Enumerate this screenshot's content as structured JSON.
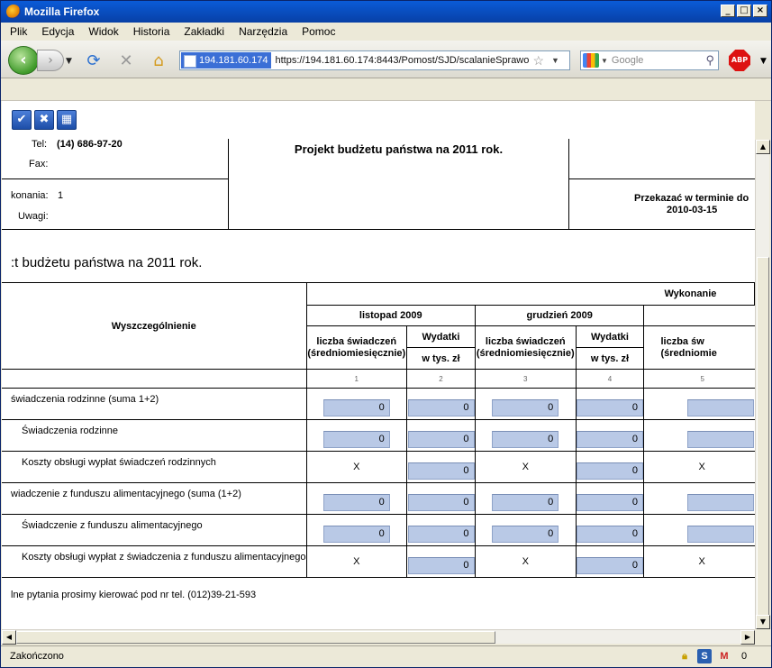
{
  "window": {
    "title": "Mozilla Firefox"
  },
  "menu": [
    "Plik",
    "Edycja",
    "Widok",
    "Historia",
    "Zakładki",
    "Narzędzia",
    "Pomoc"
  ],
  "nav": {
    "host": "194.181.60.174",
    "url": "https://194.181.60.174:8443/Pomost/SJD/scalanieSprawo",
    "search_placeholder": "Google",
    "abp_label": "ABP"
  },
  "header": {
    "tel_label": "Tel:",
    "tel_value": "(14) 686-97-20",
    "fax_label": "Fax:",
    "wykonania_label": "konania:",
    "wykonania_value": "1",
    "uwagi_label": "Uwagi:",
    "project_title": "Projekt budżetu państwa na 2011 rok.",
    "deadline_label": "Przekazać w terminie do",
    "deadline_date": "2010-03-15"
  },
  "section_title": ":t budżetu państwa na 2011 rok.",
  "table": {
    "col_main": "Wyszczególnienie",
    "group": "Wykonanie",
    "months": [
      "listopad 2009",
      "grudzień 2009"
    ],
    "sub_count": "liczba świadczeń (średniomiesięcznie)",
    "sub_count_partial": "liczba św (średniomie",
    "sub_exp": "Wydatki",
    "sub_unit": "w tys. zł",
    "col_numbers": [
      "1",
      "2",
      "3",
      "4",
      "5"
    ],
    "rows": [
      {
        "label": "świadczenia rodzinne (suma 1+2)",
        "c1": "0",
        "c2": "0",
        "c3": "0",
        "c4": "0",
        "c5": ""
      },
      {
        "label": "Świadczenia rodzinne",
        "c1": "0",
        "c2": "0",
        "c3": "0",
        "c4": "0",
        "c5": ""
      },
      {
        "label": "Koszty obsługi wypłat świadczeń rodzinnych",
        "c1": "X",
        "c2": "0",
        "c3": "X",
        "c4": "0",
        "c5": "X"
      },
      {
        "label": "wiadczenie z funduszu alimentacyjnego (suma (1+2)",
        "c1": "0",
        "c2": "0",
        "c3": "0",
        "c4": "0",
        "c5": ""
      },
      {
        "label": "Świadczenie z funduszu alimentacyjnego",
        "c1": "0",
        "c2": "0",
        "c3": "0",
        "c4": "0",
        "c5": ""
      },
      {
        "label": "Koszty obsługi wypłat z świadczenia z funduszu alimentacyjnego",
        "c1": "X",
        "c2": "0",
        "c3": "X",
        "c4": "0",
        "c5": "X"
      }
    ]
  },
  "footnote": "lne pytania prosimy kierować pod nr tel. (012)39-21-593",
  "status": {
    "text": "Zakończono",
    "mail_count": "0"
  }
}
